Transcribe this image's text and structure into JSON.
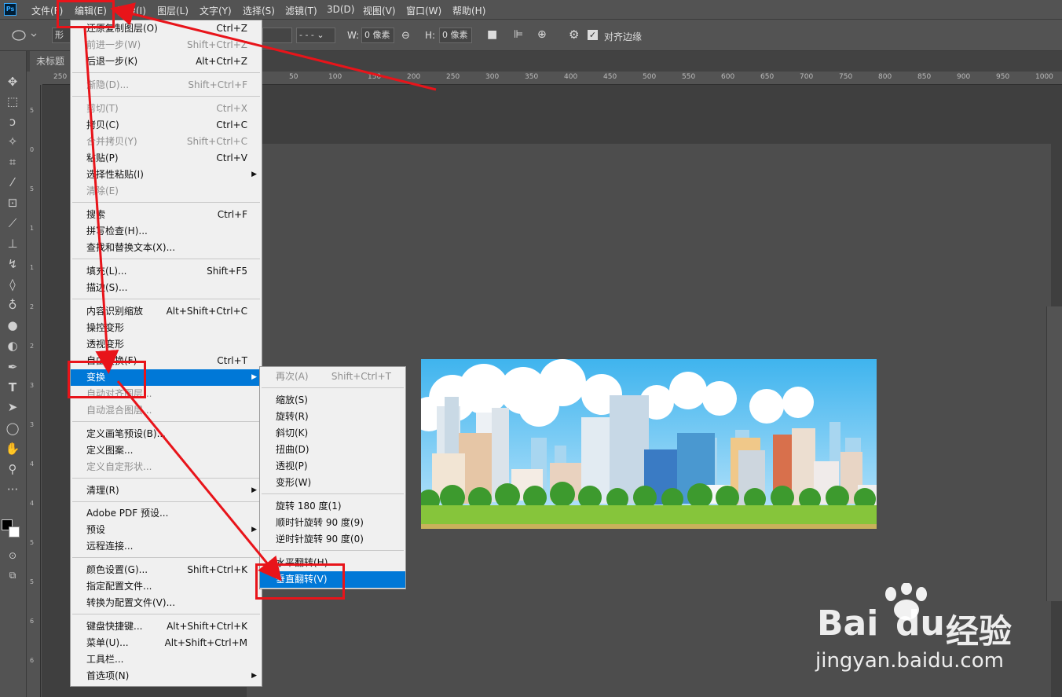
{
  "app": {
    "logo": "Ps"
  },
  "menubar": [
    "文件(F)",
    "编辑(E)",
    "图像(I)",
    "图层(L)",
    "文字(Y)",
    "选择(S)",
    "滤镜(T)",
    "3D(D)",
    "视图(V)",
    "窗口(W)",
    "帮助(H)"
  ],
  "options": {
    "shape_mode": "形",
    "w_label": "W:",
    "w_value": "0 像素",
    "h_label": "H:",
    "h_value": "0 像素",
    "align_edges": "对齐边缘"
  },
  "tab": {
    "title": "未标题"
  },
  "ruler_h": [
    "250",
    "50",
    "100",
    "150",
    "200",
    "250",
    "300",
    "350",
    "400",
    "450",
    "500",
    "550",
    "600",
    "650",
    "700",
    "750",
    "800",
    "850",
    "900",
    "950",
    "1000"
  ],
  "ruler_v": [
    "5",
    "0",
    "5",
    "0",
    "1",
    "0",
    "1",
    "5",
    "2",
    "0",
    "2",
    "5",
    "3",
    "0",
    "3",
    "5",
    "4",
    "0",
    "4",
    "5",
    "5",
    "0",
    "5",
    "5",
    "6",
    "0",
    "6",
    "5",
    "7",
    "0"
  ],
  "edit_menu": {
    "items": [
      {
        "label": "还原复制图层(O)",
        "shortcut": "Ctrl+Z",
        "disabled": false
      },
      {
        "label": "前进一步(W)",
        "shortcut": "Shift+Ctrl+Z",
        "disabled": true
      },
      {
        "label": "后退一步(K)",
        "shortcut": "Alt+Ctrl+Z",
        "disabled": false
      },
      {
        "label": "渐隐(D)...",
        "shortcut": "Shift+Ctrl+F",
        "disabled": true
      },
      {
        "label": "剪切(T)",
        "shortcut": "Ctrl+X",
        "disabled": true
      },
      {
        "label": "拷贝(C)",
        "shortcut": "Ctrl+C",
        "disabled": false
      },
      {
        "label": "合并拷贝(Y)",
        "shortcut": "Shift+Ctrl+C",
        "disabled": true
      },
      {
        "label": "粘贴(P)",
        "shortcut": "Ctrl+V",
        "disabled": false
      },
      {
        "label": "选择性粘贴(I)",
        "shortcut": "",
        "disabled": false,
        "submenu": true
      },
      {
        "label": "清除(E)",
        "shortcut": "",
        "disabled": true
      },
      {
        "label": "搜索",
        "shortcut": "Ctrl+F",
        "disabled": false
      },
      {
        "label": "拼写检查(H)...",
        "shortcut": "",
        "disabled": false
      },
      {
        "label": "查找和替换文本(X)...",
        "shortcut": "",
        "disabled": false
      },
      {
        "label": "填充(L)...",
        "shortcut": "Shift+F5",
        "disabled": false
      },
      {
        "label": "描边(S)...",
        "shortcut": "",
        "disabled": false
      },
      {
        "label": "内容识别缩放",
        "shortcut": "Alt+Shift+Ctrl+C",
        "disabled": false
      },
      {
        "label": "操控变形",
        "shortcut": "",
        "disabled": false
      },
      {
        "label": "透视变形",
        "shortcut": "",
        "disabled": false
      },
      {
        "label": "自由变换(F)",
        "shortcut": "Ctrl+T",
        "disabled": false
      },
      {
        "label": "变换",
        "shortcut": "",
        "disabled": false,
        "submenu": true,
        "highlighted": true
      },
      {
        "label": "自动对齐图层...",
        "shortcut": "",
        "disabled": true
      },
      {
        "label": "自动混合图层...",
        "shortcut": "",
        "disabled": true
      },
      {
        "label": "定义画笔预设(B)...",
        "shortcut": "",
        "disabled": false
      },
      {
        "label": "定义图案...",
        "shortcut": "",
        "disabled": false
      },
      {
        "label": "定义自定形状...",
        "shortcut": "",
        "disabled": true
      },
      {
        "label": "清理(R)",
        "shortcut": "",
        "disabled": false,
        "submenu": true
      },
      {
        "label": "Adobe PDF 预设...",
        "shortcut": "",
        "disabled": false
      },
      {
        "label": "预设",
        "shortcut": "",
        "disabled": false,
        "submenu": true
      },
      {
        "label": "远程连接...",
        "shortcut": "",
        "disabled": false
      },
      {
        "label": "颜色设置(G)...",
        "shortcut": "Shift+Ctrl+K",
        "disabled": false
      },
      {
        "label": "指定配置文件...",
        "shortcut": "",
        "disabled": false
      },
      {
        "label": "转换为配置文件(V)...",
        "shortcut": "",
        "disabled": false
      },
      {
        "label": "键盘快捷键...",
        "shortcut": "Alt+Shift+Ctrl+K",
        "disabled": false
      },
      {
        "label": "菜单(U)...",
        "shortcut": "Alt+Shift+Ctrl+M",
        "disabled": false
      },
      {
        "label": "工具栏...",
        "shortcut": "",
        "disabled": false
      },
      {
        "label": "首选项(N)",
        "shortcut": "",
        "disabled": false,
        "submenu": true
      }
    ]
  },
  "transform_menu": {
    "items": [
      {
        "label": "再次(A)",
        "shortcut": "Shift+Ctrl+T",
        "disabled": true
      },
      {
        "label": "缩放(S)",
        "shortcut": "",
        "disabled": false
      },
      {
        "label": "旋转(R)",
        "shortcut": "",
        "disabled": false
      },
      {
        "label": "斜切(K)",
        "shortcut": "",
        "disabled": false
      },
      {
        "label": "扭曲(D)",
        "shortcut": "",
        "disabled": false
      },
      {
        "label": "透视(P)",
        "shortcut": "",
        "disabled": false
      },
      {
        "label": "变形(W)",
        "shortcut": "",
        "disabled": false
      },
      {
        "label": "旋转 180 度(1)",
        "shortcut": "",
        "disabled": false
      },
      {
        "label": "顺时针旋转 90 度(9)",
        "shortcut": "",
        "disabled": false
      },
      {
        "label": "逆时针旋转 90 度(0)",
        "shortcut": "",
        "disabled": false
      },
      {
        "label": "水平翻转(H)",
        "shortcut": "",
        "disabled": false
      },
      {
        "label": "垂直翻转(V)",
        "shortcut": "",
        "disabled": false,
        "highlighted": true
      }
    ]
  },
  "watermark": {
    "brand": "Bai",
    "brand2": "du",
    "cn": "经验",
    "url": "jingyan.baidu.com"
  },
  "colors": {
    "highlight": "#0078d7",
    "annotation": "#e8141a",
    "menu_bg": "#f0f0f0",
    "ui_bg": "#535353"
  }
}
